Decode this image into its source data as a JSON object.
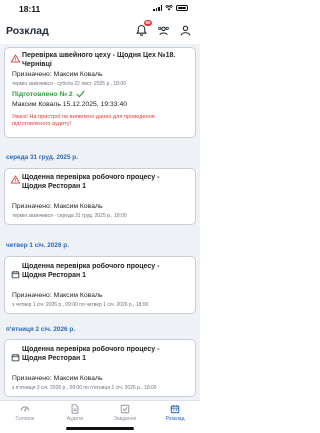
{
  "status": {
    "time": "18:11"
  },
  "header": {
    "title": "Розклад",
    "notification_count": "60",
    "icons": [
      "notification-bell-icon",
      "team-icon",
      "user-icon"
    ]
  },
  "cards": [
    {
      "type": "overdue",
      "icon": "warning-triangle-icon",
      "title": "Перевірка швейного цеху - Щодня Цех №18. Чернівці",
      "assignee_line": "Призначено: Максим Коваль",
      "deadline": "термін закінчився - субота 22 лист. 2025 р., 18:00",
      "prepared_label": "Підготовлено № 2",
      "prepared_by": "Максим Коваль 15.12.2025, 19:33:40",
      "warning": "Увага! На пристрої не виявлено даних для проведення підготовленого аудиту!"
    },
    {
      "date_header": "середа 31 груд. 2025 р.",
      "type": "overdue",
      "icon": "warning-triangle-icon",
      "title": "Щоденна перевірка робочого процесу - Щодня Ресторан 1",
      "assignee_line": "Призначено: Максим Коваль",
      "deadline": "термін закінчився - середа 31 груд. 2025 р., 18:00"
    },
    {
      "date_header": "четвер 1 січ. 2026 р.",
      "type": "scheduled",
      "icon": "calendar-icon",
      "title": "Щоденна перевірка робочого процесу - Щодня Ресторан 1",
      "assignee_line": "Призначено: Максим Коваль",
      "deadline": "з четвер 1 січ. 2026 р., 09:00 по четвер 1 січ. 2026 р., 18:00"
    },
    {
      "date_header": "п'ятниця 2 січ. 2026 р.",
      "type": "scheduled",
      "icon": "calendar-icon",
      "title": "Щоденна перевірка робочого процесу - Щодня Ресторан 1",
      "assignee_line": "Призначено: Максим Коваль",
      "deadline": "з п'ятниця 2 січ. 2026 р., 09:00 по п'ятниця 2 січ. 2026 р., 18:00"
    }
  ],
  "tabs": [
    {
      "label": "Головне",
      "icon": "dashboard-icon",
      "active": false
    },
    {
      "label": "Аудити",
      "icon": "document-icon",
      "active": false
    },
    {
      "label": "Завдання",
      "icon": "checkbox-icon",
      "active": false
    },
    {
      "label": "Розклад",
      "icon": "calendar-icon",
      "active": true
    }
  ],
  "colors": {
    "accent": "#1f5fb0",
    "date_header": "#2c6bb8",
    "danger": "#e53935",
    "success": "#2e9b3e",
    "background": "#eef1f5"
  }
}
